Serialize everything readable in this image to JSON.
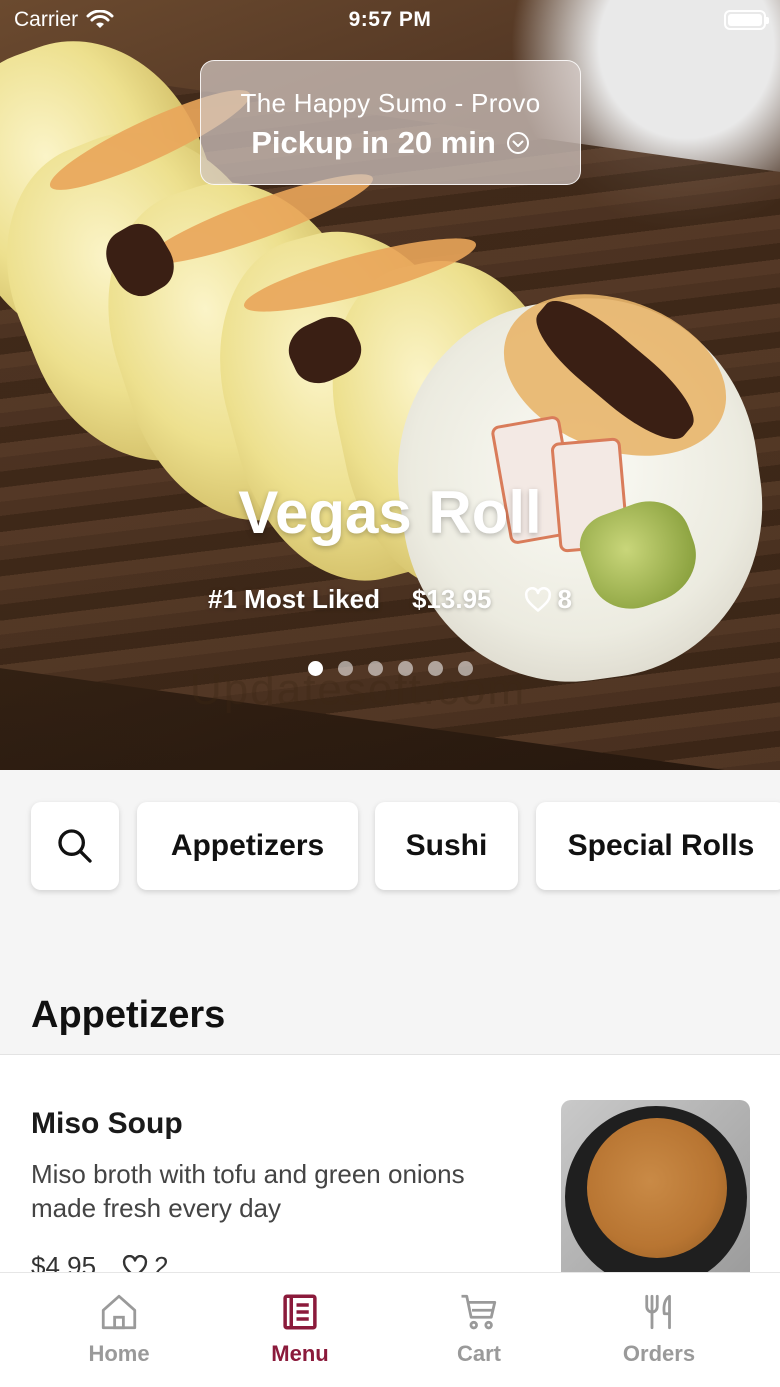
{
  "status_bar": {
    "carrier": "Carrier",
    "time": "9:57 PM"
  },
  "location": {
    "store": "The Happy Sumo - Provo",
    "pickup": "Pickup in 20 min"
  },
  "featured": {
    "title": "Vegas Roll",
    "rank": "#1 Most Liked",
    "price": "$13.95",
    "likes": "8",
    "slide_count": 6,
    "active_slide": 1
  },
  "watermark": "Updatesoft.com",
  "categories": {
    "search_icon": "search-icon",
    "items": [
      "Appetizers",
      "Sushi",
      "Special Rolls"
    ]
  },
  "section": {
    "title": "Appetizers"
  },
  "menu_items": [
    {
      "name": "Miso Soup",
      "description": "Miso broth with tofu and green onions made fresh every day",
      "price": "$4.95",
      "likes": "2"
    }
  ],
  "tab_bar": {
    "tabs": [
      {
        "label": "Home",
        "icon": "home-icon"
      },
      {
        "label": "Menu",
        "icon": "menu-icon"
      },
      {
        "label": "Cart",
        "icon": "cart-icon"
      },
      {
        "label": "Orders",
        "icon": "utensils-icon"
      }
    ],
    "active": "Menu",
    "active_color": "#8b1a3b",
    "inactive_color": "#9a9a9a"
  }
}
